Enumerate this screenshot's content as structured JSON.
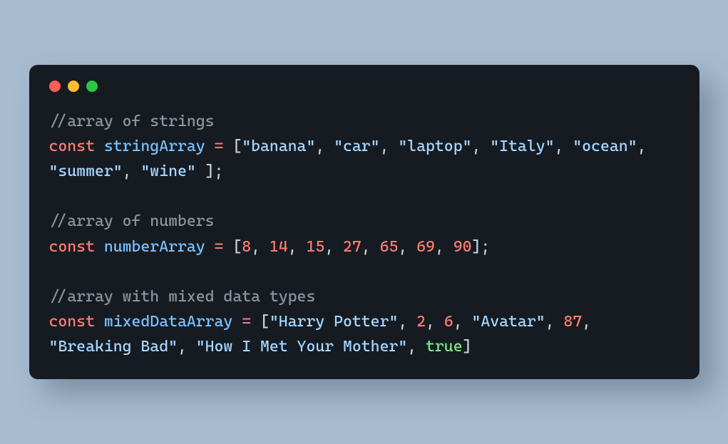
{
  "code": {
    "tokens": [
      {
        "cls": "tok-comment",
        "text": "//array of strings"
      },
      {
        "cls": "nl"
      },
      {
        "cls": "tok-keyword",
        "text": "const"
      },
      {
        "cls": "tok-text",
        "text": " "
      },
      {
        "cls": "tok-varname",
        "text": "stringArray"
      },
      {
        "cls": "tok-text",
        "text": " "
      },
      {
        "cls": "tok-operator",
        "text": "="
      },
      {
        "cls": "tok-text",
        "text": " "
      },
      {
        "cls": "tok-punct",
        "text": "["
      },
      {
        "cls": "tok-string",
        "text": "\"banana\""
      },
      {
        "cls": "tok-punct",
        "text": ", "
      },
      {
        "cls": "tok-string",
        "text": "\"car\""
      },
      {
        "cls": "tok-punct",
        "text": ", "
      },
      {
        "cls": "tok-string",
        "text": "\"laptop\""
      },
      {
        "cls": "tok-punct",
        "text": ", "
      },
      {
        "cls": "tok-string",
        "text": "\"Italy\""
      },
      {
        "cls": "tok-punct",
        "text": ", "
      },
      {
        "cls": "tok-string",
        "text": "\"ocean\""
      },
      {
        "cls": "tok-punct",
        "text": ", "
      },
      {
        "cls": "tok-string",
        "text": "\"summer\""
      },
      {
        "cls": "tok-punct",
        "text": ", "
      },
      {
        "cls": "tok-string",
        "text": "\"wine\""
      },
      {
        "cls": "tok-punct",
        "text": " ];"
      },
      {
        "cls": "nl"
      },
      {
        "cls": "nl"
      },
      {
        "cls": "tok-comment",
        "text": "//array of numbers"
      },
      {
        "cls": "nl"
      },
      {
        "cls": "tok-keyword",
        "text": "const"
      },
      {
        "cls": "tok-text",
        "text": " "
      },
      {
        "cls": "tok-varname",
        "text": "numberArray"
      },
      {
        "cls": "tok-text",
        "text": " "
      },
      {
        "cls": "tok-operator",
        "text": "="
      },
      {
        "cls": "tok-text",
        "text": " "
      },
      {
        "cls": "tok-punct",
        "text": "["
      },
      {
        "cls": "tok-number",
        "text": "8"
      },
      {
        "cls": "tok-punct",
        "text": ", "
      },
      {
        "cls": "tok-number",
        "text": "14"
      },
      {
        "cls": "tok-punct",
        "text": ", "
      },
      {
        "cls": "tok-number",
        "text": "15"
      },
      {
        "cls": "tok-punct",
        "text": ", "
      },
      {
        "cls": "tok-number",
        "text": "27"
      },
      {
        "cls": "tok-punct",
        "text": ", "
      },
      {
        "cls": "tok-number",
        "text": "65"
      },
      {
        "cls": "tok-punct",
        "text": ", "
      },
      {
        "cls": "tok-number",
        "text": "69"
      },
      {
        "cls": "tok-punct",
        "text": ", "
      },
      {
        "cls": "tok-number",
        "text": "90"
      },
      {
        "cls": "tok-punct",
        "text": "];"
      },
      {
        "cls": "nl"
      },
      {
        "cls": "nl"
      },
      {
        "cls": "tok-comment",
        "text": "//array with mixed data types"
      },
      {
        "cls": "nl"
      },
      {
        "cls": "tok-keyword",
        "text": "const"
      },
      {
        "cls": "tok-text",
        "text": " "
      },
      {
        "cls": "tok-varname",
        "text": "mixedDataArray"
      },
      {
        "cls": "tok-text",
        "text": " "
      },
      {
        "cls": "tok-operator",
        "text": "="
      },
      {
        "cls": "tok-text",
        "text": " "
      },
      {
        "cls": "tok-punct",
        "text": "["
      },
      {
        "cls": "tok-string",
        "text": "\"Harry Potter\""
      },
      {
        "cls": "tok-punct",
        "text": ", "
      },
      {
        "cls": "tok-number",
        "text": "2"
      },
      {
        "cls": "tok-punct",
        "text": ", "
      },
      {
        "cls": "tok-number",
        "text": "6"
      },
      {
        "cls": "tok-punct",
        "text": ", "
      },
      {
        "cls": "tok-string",
        "text": "\"Avatar\""
      },
      {
        "cls": "tok-punct",
        "text": ", "
      },
      {
        "cls": "tok-number",
        "text": "87"
      },
      {
        "cls": "tok-punct",
        "text": ", "
      },
      {
        "cls": "tok-string",
        "text": "\"Breaking Bad\""
      },
      {
        "cls": "tok-punct",
        "text": ", "
      },
      {
        "cls": "tok-string",
        "text": "\"How I Met Your Mother\""
      },
      {
        "cls": "tok-punct",
        "text": ", "
      },
      {
        "cls": "tok-bool",
        "text": "true"
      },
      {
        "cls": "tok-punct",
        "text": "]"
      }
    ]
  }
}
